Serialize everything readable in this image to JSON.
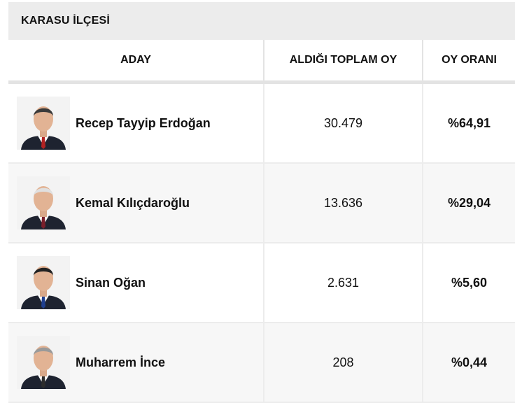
{
  "title": "KARASU İLÇESİ",
  "headers": {
    "candidate": "ADAY",
    "votes": "ALDIĞI TOPLAM OY",
    "ratio": "OY ORANI"
  },
  "rows": [
    {
      "name": "Recep Tayyip Erdoğan",
      "votes": "30.479",
      "ratio": "%64,91",
      "hair": "#3a3a3a",
      "tie": "#b22222"
    },
    {
      "name": "Kemal Kılıçdaroğlu",
      "votes": "13.636",
      "ratio": "%29,04",
      "hair": "#e0e0e0",
      "tie": "#7a1f2b"
    },
    {
      "name": "Sinan Oğan",
      "votes": "2.631",
      "ratio": "%5,60",
      "hair": "#222222",
      "tie": "#1f3f8f"
    },
    {
      "name": "Muharrem İnce",
      "votes": "208",
      "ratio": "%0,44",
      "hair": "#9a9a9a",
      "tie": "#2d2d2d"
    }
  ]
}
